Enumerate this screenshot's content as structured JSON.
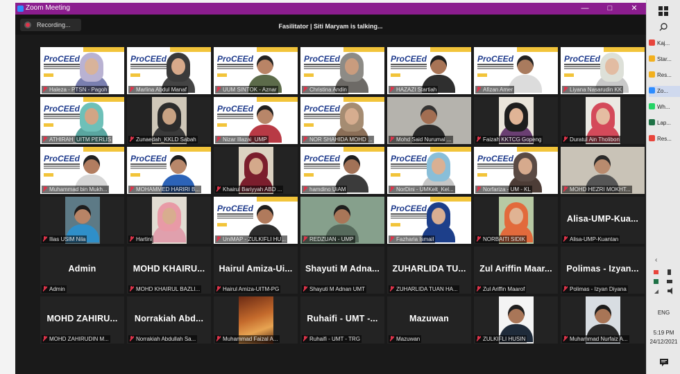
{
  "window": {
    "title": "Zoom Meeting",
    "minimize": "—",
    "maximize": "□",
    "close": "✕"
  },
  "meeting": {
    "recording_label": "Recording...",
    "speaker_status": "Fasilitator | Siti Maryam is talking..."
  },
  "slide": {
    "logo_text": "ProCEEd"
  },
  "participants": [
    {
      "label": "Haleza - PTSN - Pagoh",
      "kind": "slide",
      "skin": "#d8b39a",
      "hijab": "#b9b2d2",
      "shirt": "#7a7fb0"
    },
    {
      "label": "Marlina Abdul Manaf",
      "kind": "slide",
      "skin": "#d7a98a",
      "hijab": "#3a3a3a",
      "shirt": "#444"
    },
    {
      "label": "UUM SINTOK - Aznar",
      "kind": "slide",
      "skin": "#b98466",
      "hair": "#222",
      "shirt": "#5c6b4a"
    },
    {
      "label": "Christina Andin",
      "kind": "slide",
      "skin": "#c99c7e",
      "hijab": "#8d8b86",
      "shirt": "#6d6a66"
    },
    {
      "label": "HAZAZI Startiah",
      "kind": "slide",
      "skin": "#a87456",
      "hair": "#1e1e1e",
      "shirt": "#2f2f2f"
    },
    {
      "label": "Afizan Amer",
      "kind": "slide",
      "skin": "#a97b5e",
      "hair": "#222",
      "shirt": "#dcdcdc"
    },
    {
      "label": "Liyana Nasarudin KK",
      "kind": "slide",
      "skin": "#e2bca2",
      "hijab": "#dde0d8",
      "shirt": "#c9c9c9"
    },
    {
      "label": "ATHIRAH_UITM PERLIS",
      "kind": "slide",
      "skin": "#d2a585",
      "hijab": "#6ec0b8",
      "shirt": "#5aa6a0"
    },
    {
      "label": "Zunaedah_KKLD Sabah",
      "kind": "crop",
      "bg": "#cfc7b8",
      "skin": "#c8a283",
      "hijab": "#2c2c2c",
      "shirt": "#3a3a3a"
    },
    {
      "label": "Nizar Illazai_UMP",
      "kind": "slide",
      "skin": "#b88669",
      "hair": "#1f1f1f",
      "shirt": "#b83a45"
    },
    {
      "label": "NOR SHAHIDA MOHD ...",
      "kind": "slide",
      "skin": "#d6ad8f",
      "hijab": "#a58c72",
      "shirt": "#8b6f58"
    },
    {
      "label": "Mohd Said Nurumal ...",
      "kind": "video",
      "bg": "#b5b3ad",
      "skin": "#a26e52",
      "hair": "#333",
      "shirt": "#2b2b2b"
    },
    {
      "label": "Faizah KKTCG Gopeng",
      "kind": "crop",
      "bg": "#e9e4da",
      "skin": "#e0b496",
      "hijab": "#1e1e1e",
      "shirt": "#6a3e72"
    },
    {
      "label": "Duratul Ain Tholibon",
      "kind": "crop",
      "bg": "#ebe9e3",
      "skin": "#e5bda2",
      "hijab": "#d44a5a",
      "shirt": "#d44a5a"
    },
    {
      "label": "Muhammad bin Mukh...",
      "kind": "slide",
      "skin": "#b27d60",
      "hair": "#222",
      "shirt": "#d6d6d6"
    },
    {
      "label": "MOHAMMED HARIRI B...",
      "kind": "slide",
      "skin": "#b8876a",
      "hair": "#1d1d1d",
      "shirt": "#2c63b8"
    },
    {
      "label": "Khairul Bariyyah ABD ...",
      "kind": "crop",
      "bg": "#dcd2c2",
      "skin": "#d4a98b",
      "hijab": "#7b1e2d",
      "shirt": "#7b1e2d"
    },
    {
      "label": "hamdino UiAM",
      "kind": "slide",
      "skin": "#a27257",
      "hair": "#1f1f1f",
      "shirt": "#3b3b3b"
    },
    {
      "label": "NorDini - UMKelt_Kel...",
      "kind": "slide",
      "skin": "#d9b093",
      "hijab": "#89bed8",
      "shirt": "#c6c6c6"
    },
    {
      "label": "Norfariza - UM - KL",
      "kind": "slide",
      "skin": "#d6aa8d",
      "hijab": "#5a4a44",
      "shirt": "#4d3d37"
    },
    {
      "label": "MOHD HEZRI MOKHT...",
      "kind": "video",
      "bg": "#c9c3b7",
      "skin": "#b98b6e",
      "hair": "#2a2a2a",
      "shirt": "#565656"
    },
    {
      "label": "Ilias USIM Nila",
      "kind": "crop",
      "bg": "#5d7a86",
      "skin": "#b88466",
      "hair": "#1d1d1d",
      "shirt": "#2f8fc9"
    },
    {
      "label": "Hartini",
      "kind": "crop",
      "bg": "#e2dcd2",
      "skin": "#d8ad8f",
      "hijab": "#e89aa6",
      "shirt": "#e0a0ad"
    },
    {
      "label": "UniMAP - ZULKIFLI HU...",
      "kind": "slide",
      "skin": "#b07a5c",
      "hair": "#1e1e1e",
      "shirt": "#2d2d2d"
    },
    {
      "label": "REDZUAN - UMP",
      "kind": "video",
      "bg": "#86a08c",
      "skin": "#a97658",
      "hair": "#1e1e1e",
      "shirt": "#566a5c"
    },
    {
      "label": "Fazharia Ismail",
      "kind": "slide",
      "skin": "#d9ae92",
      "hijab": "#1d3f8a",
      "shirt": "#1d3f8a"
    },
    {
      "label": "NORBAITI SIDIK",
      "kind": "crop",
      "bg": "#b7c9a4",
      "skin": "#e0b393",
      "hijab": "#e26a3c",
      "shirt": "#e26a3c"
    },
    {
      "label": "Alisa-UMP-Kuantan",
      "kind": "name",
      "display": "Alisa-UMP-Kua..."
    },
    {
      "label": "Admin",
      "kind": "name",
      "display": "Admin"
    },
    {
      "label": "MOHD KHAIRUL BAZLI...",
      "kind": "name",
      "display": "MOHD KHAIRU..."
    },
    {
      "label": "Hairul Amiza-UITM-PG",
      "kind": "name",
      "display": "Hairul Amiza-Ui..."
    },
    {
      "label": "Shayuti M Adnan UMT",
      "kind": "name",
      "display": "Shayuti M Adna..."
    },
    {
      "label": "ZUHARLIDA TUAN HA...",
      "kind": "name",
      "display": "ZUHARLIDA TU..."
    },
    {
      "label": "Zul Ariffin Maarof",
      "kind": "name",
      "display": "Zul Ariffin Maar..."
    },
    {
      "label": "Polimas - Izyan Diyana",
      "kind": "name",
      "display": "Polimas - Izyan..."
    },
    {
      "label": "MOHD ZAHIRUDIN M...",
      "kind": "name",
      "display": "MOHD ZAHIRU..."
    },
    {
      "label": "Norrakiah Abdullah Sa...",
      "kind": "name",
      "display": "Norrakiah Abd..."
    },
    {
      "label": "Muhammad Faizal A...",
      "kind": "photo",
      "bg": "#b85a2a"
    },
    {
      "label": "Ruhaifi - UMT - TRG",
      "kind": "name",
      "display": "Ruhaifi - UMT -..."
    },
    {
      "label": "Mazuwan",
      "kind": "name",
      "display": "Mazuwan"
    },
    {
      "label": "ZULKIFLI HUSIN",
      "kind": "cropslide",
      "bg": "#f4f4f4",
      "skin": "#a97658",
      "hair": "#1e1e1e",
      "shirt": "#1f2b3a"
    },
    {
      "label": "Muhammad Nurfaiz A...",
      "kind": "crop",
      "bg": "#d8dde2",
      "skin": "#a87556",
      "hair": "#1b1b1b",
      "shirt": "#2b2b2b"
    }
  ],
  "taskbar": {
    "apps": [
      {
        "label": "Kaj...",
        "color": "#e8453c"
      },
      {
        "label": "Star...",
        "color": "#f2b01e"
      },
      {
        "label": "Res...",
        "color": "#f2b01e"
      },
      {
        "label": "Zo...",
        "color": "#2d8cff"
      },
      {
        "label": "Wh...",
        "color": "#25d366"
      },
      {
        "label": "Lap...",
        "color": "#1e7145"
      },
      {
        "label": "Res...",
        "color": "#e8453c"
      }
    ],
    "language": "ENG",
    "time": "5:19 PM",
    "date": "24/12/2021"
  }
}
